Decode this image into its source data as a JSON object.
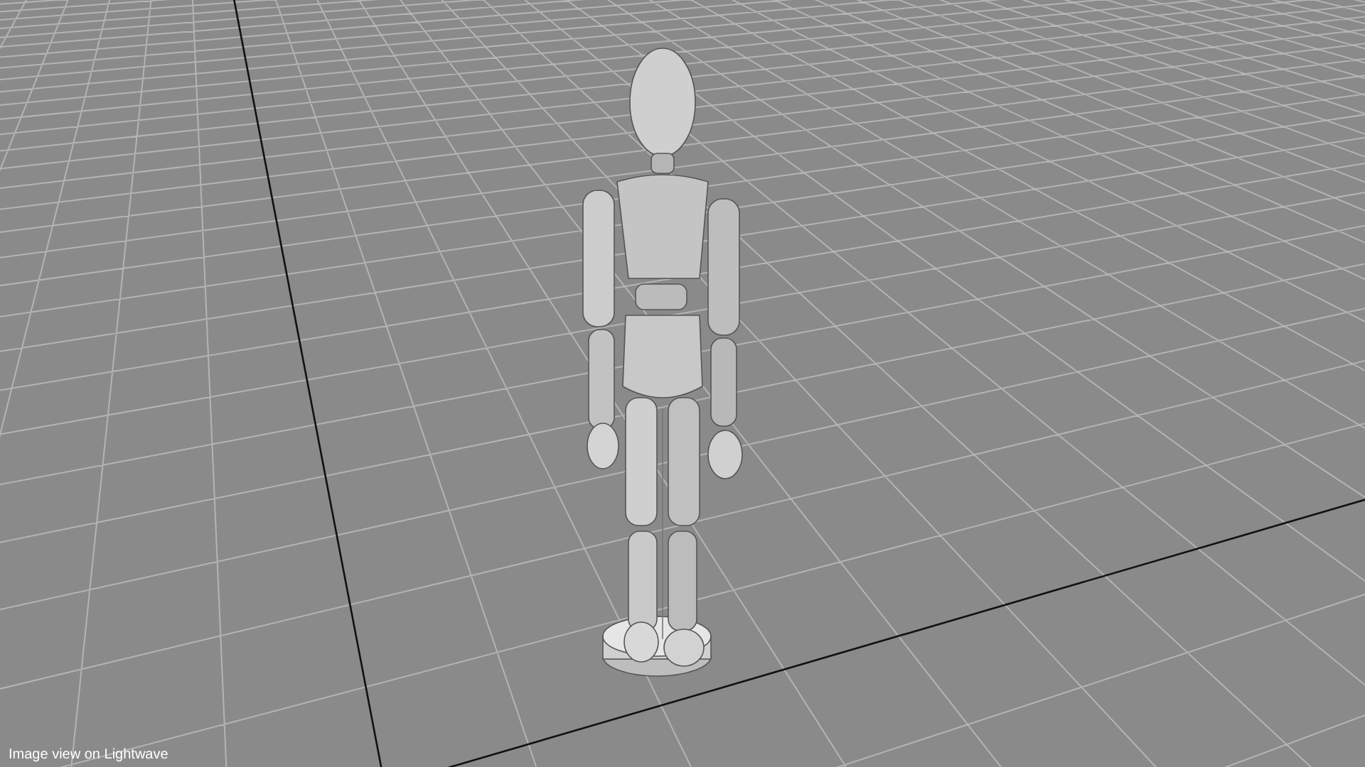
{
  "viewport": {
    "caption": "Image view on Lightwave"
  }
}
